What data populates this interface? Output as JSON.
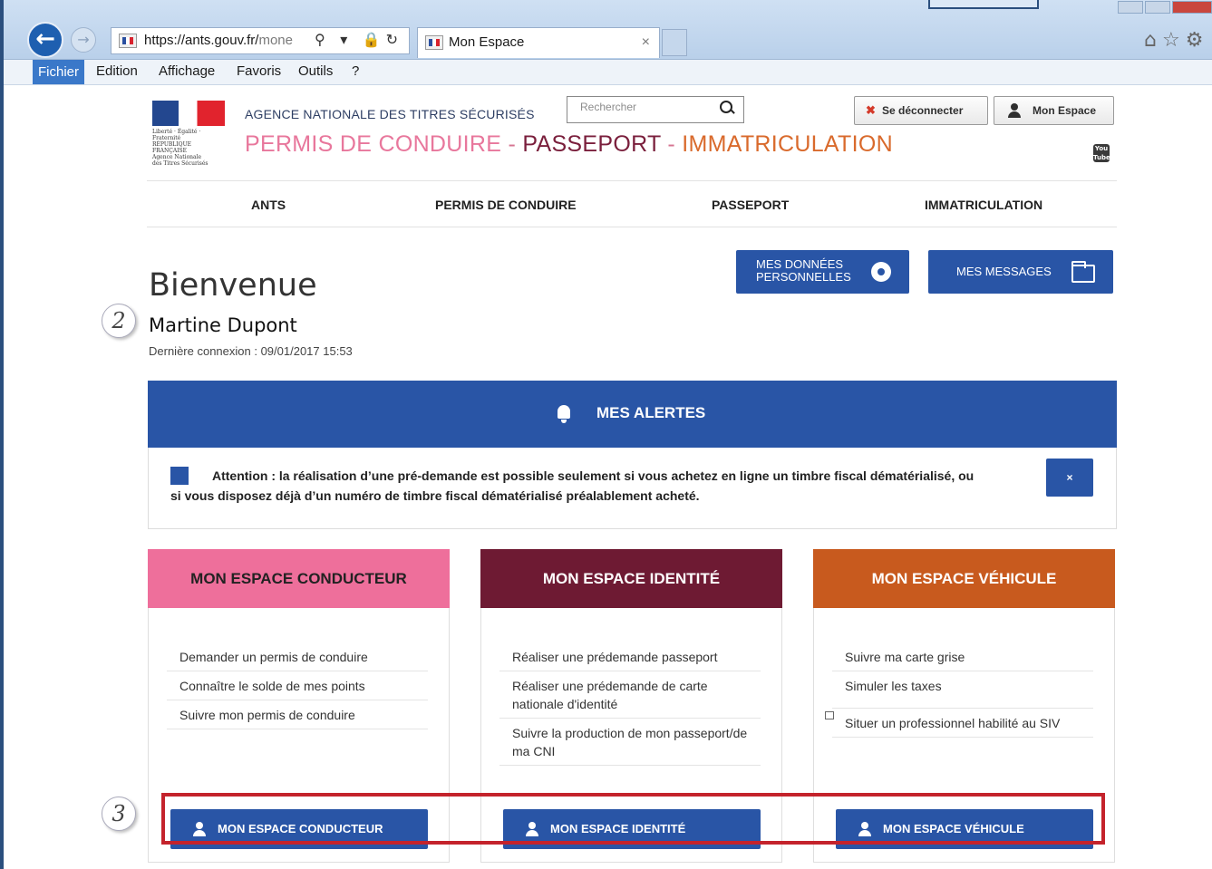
{
  "browser": {
    "url_main": "https://ants.gouv.fr/",
    "url_dim": "mone",
    "tab_title": "Mon Espace",
    "tab_close": "×",
    "menu": [
      "Fichier",
      "Edition",
      "Affichage",
      "Favoris",
      "Outils",
      "?"
    ]
  },
  "header": {
    "logo_lines": [
      "Liberté · Égalité · Fraternité",
      "RÉPUBLIQUE FRANÇAISE",
      "Agence Nationale",
      "des Titres Sécurisés"
    ],
    "agency": "AGENCE NATIONALE DES TITRES SÉCURISÉS",
    "permis": "PERMIS DE CONDUIRE",
    "sep1": " - ",
    "passeport": "PASSEPORT",
    "sep2": " - ",
    "immat": "IMMATRICULATION",
    "search_placeholder": "Rechercher",
    "logout_label": "Se déconnecter",
    "mon_espace_label": "Mon Espace",
    "youtube_label": "You Tube"
  },
  "nav": [
    "ANTS",
    "PERMIS DE CONDUIRE",
    "PASSEPORT",
    "IMMATRICULATION"
  ],
  "actions": {
    "donnees_line1": "MES DONNÉES",
    "donnees_line2": "PERSONNELLES",
    "messages": "MES MESSAGES"
  },
  "welcome": {
    "title": "Bienvenue",
    "name": "Martine Dupont",
    "last_login": "Dernière connexion : 09/01/2017 15:53"
  },
  "callouts": [
    "2",
    "3"
  ],
  "alerts": {
    "title": "MES ALERTES",
    "text": "Attention : la réalisation d’une pré-demande est possible seulement si vous achetez en ligne un timbre fiscal dématérialisé, ou si vous disposez déjà d’un numéro de timbre fiscal dématérialisé préalablement acheté.",
    "close": "×"
  },
  "cards": [
    {
      "title": "MON ESPACE CONDUCTEUR",
      "color": "#ee6f9b",
      "links": [
        "Demander un permis de conduire",
        "Connaître le solde de mes points",
        "Suivre mon permis de conduire"
      ],
      "button": "MON ESPACE CONDUCTEUR"
    },
    {
      "title": "MON ESPACE IDENTITÉ",
      "color": "#6e1a33",
      "links": [
        "Réaliser une prédemande passeport",
        "Réaliser une prédemande de carte nationale d'identité",
        "Suivre la production de mon passeport/de ma CNI"
      ],
      "button": "MON ESPACE IDENTITÉ"
    },
    {
      "title": "MON ESPACE VÉHICULE",
      "color": "#c85a1e",
      "links": [
        "Suivre ma carte grise",
        "Simuler les taxes",
        "Situer un professionnel habilité au SIV"
      ],
      "button": "MON ESPACE VÉHICULE"
    }
  ]
}
